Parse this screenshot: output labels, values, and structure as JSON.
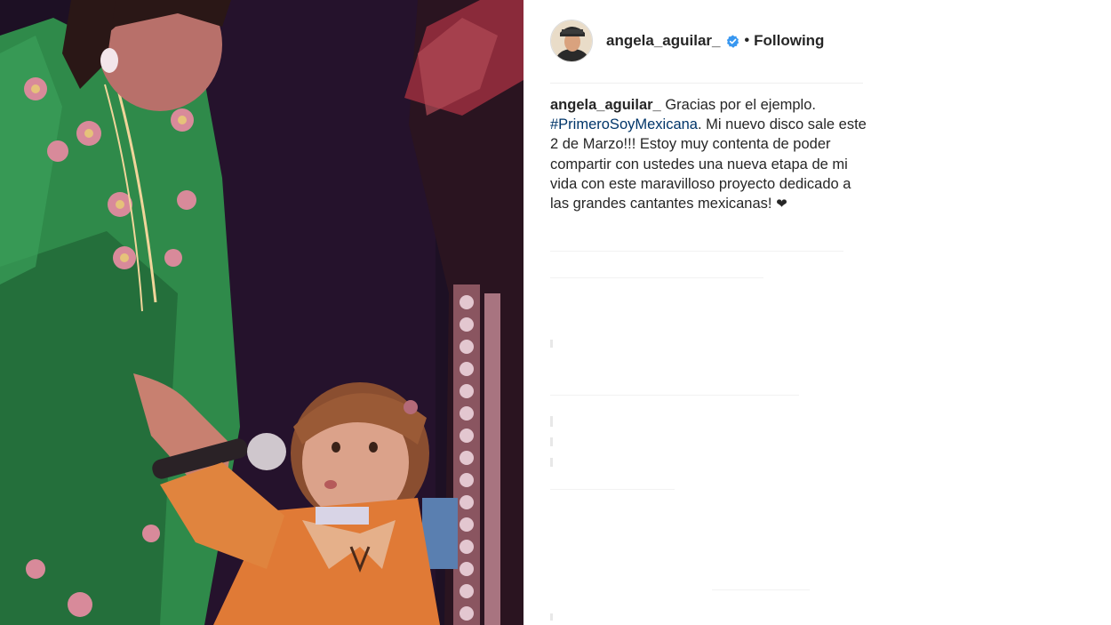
{
  "post": {
    "username": "angela_aguilar_",
    "follow_status": "Following",
    "separator": "•",
    "caption": {
      "username": "angela_aguilar_",
      "text_part1": " Gracias por el ejemplo. ",
      "hashtag": "#PrimeroSoyMexicana",
      "text_part2": ". Mi nuevo disco sale este 2 de Marzo!!! Estoy muy contenta de poder compartir con ustedes una nueva etapa de mi vida con este maravilloso proyecto dedicado a las grandes cantantes mexicanas! ",
      "emoji": "❤"
    }
  },
  "colors": {
    "verified_badge": "#3897f0",
    "hashtag_link": "#003569",
    "text": "#262626",
    "divider": "#efefef"
  },
  "icons": {
    "verified": "verified-badge-icon",
    "heart": "heart-emoji"
  }
}
